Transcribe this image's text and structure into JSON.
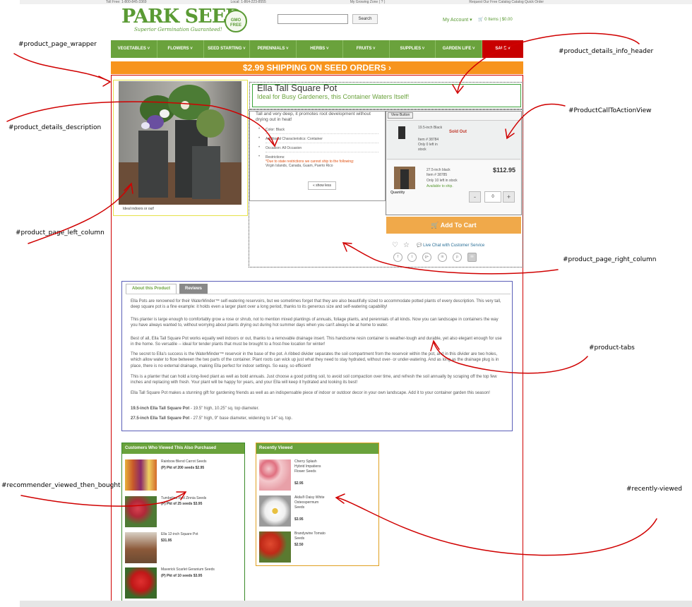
{
  "header": {
    "toll_free": "Toll Free: 1-800-845-3369",
    "local": "Local: 1-864-223-8555",
    "growing_zone": "My Growing Zone (  ?  )",
    "top_links": "Request Our Free Catalog  Catalog Quick Order",
    "brand": "PARK SEED",
    "tagline": "Superior Germination Guaranteed!",
    "gmo_badge": "GMO FREE",
    "search_placeholder": "",
    "search_button": "Search",
    "account": "My Account ▾",
    "cart": "0 Items | $0.00"
  },
  "nav": {
    "items": [
      "VEGETABLES ˅",
      "FLOWERS ˅",
      "SEED STARTING ˅",
      "PERENNIALS ˅",
      "HERBS ˅",
      "FRUITS ˅",
      "SUPPLIES ˅",
      "GARDEN LIFE ˅",
      "SALE ˅"
    ]
  },
  "promo": {
    "text": "$2.99 SHIPPING ON SEED ORDERS ›"
  },
  "product": {
    "title": "Ella Tall Square Pot",
    "subtitle": "Ideal for Busy Gardeners, this Container Waters Itself!",
    "image_caption": "Ideal indoors or out!",
    "description": "Tall and very deep, it promotes root development without drying out in heat!",
    "specs": [
      {
        "label": "Color:",
        "value": "Black"
      },
      {
        "label": "Additional Characteristics:",
        "value": "Container"
      },
      {
        "label": "Occasion:",
        "value": "All Occasion"
      },
      {
        "label": "Restrictions:",
        "value": "*Due to state restrictions we cannot ship to the following:",
        "extra": "Virgin Islands, Canada, Guam, Puerto Rico"
      }
    ],
    "show_less": "« show less"
  },
  "cta": {
    "view_button": "View Button",
    "option1": {
      "name": "19.5-inch Black",
      "item": "Item # 38784",
      "stock": "Only 0 left in stock",
      "status": "Sold Out"
    },
    "option2": {
      "name": "27.5-inch black",
      "item": "Item # 38785",
      "stock": "Only 10 left in stock",
      "ship": "Available to ship.",
      "price": "$112.95",
      "qty_label": "Quantity",
      "qty": "0",
      "minus": "-",
      "plus": "+"
    },
    "add_to_cart": "Add To Cart",
    "live_chat": "Live Chat with Customer Service",
    "social": [
      "f",
      "t",
      "g+",
      "in",
      "p",
      "✉"
    ]
  },
  "tabs": {
    "about": "About this Product",
    "reviews": "Reviews",
    "paragraphs": [
      "Ella Pots are renowned for their WaterMinder™ self-watering reservoirs, but we sometimes forget that they are also beautifully sized to accommodate potted plants of every description. This very tall, deep square pot is a fine example: it holds even a larger plant over a long period, thanks to its generous size and self-watering capability!",
      "This planter is large enough to comfortably grow a rose or shrub, not to mention mixed plantings of annuals, foliage plants, and perennials of all kinds. Now you can landscape in containers the way you have always wanted to, without worrying about plants drying out during hot summer days when you can't always be at home to water.",
      "Best of all, Ella Tall Square Pot works equally well indoors or out, thanks to a removable drainage insert. This handsome resin container is weather-tough and durable, yet also elegant enough for use in the home. So versatile -- ideal for tender plants that must be brought to a frost-free location for winter!",
      "The secret to Ella's success is the WaterMinder™ reservoir in the base of the pot. A ribbed divider separates the soil compartment from the reservoir within the pot, and in this divider are two holes, which allow water to flow between the two parts of the container. Plant roots can wick up just what they need to stay hydrated, without over- or under-watering. And as long as the drainage plug is in place, there is no external drainage, making Ella perfect for indoor settings. So easy, so efficient!",
      "This is a planter that can hold a long-lived plant as well as bold annuals. Just choose a good potting soil, to avoid soil compaction over time, and refresh the soil annually by scraping off the top few inches and replacing with fresh. Your plant will be happy for years, and your Ella will keep it hydrated and looking its best!",
      "Ella Tall Square Pot makes a stunning gift for gardening friends as well as an indispensable piece of indoor or outdoor decor in your own landscape. Add it to your container garden this season!"
    ],
    "size1_label": "19.5-inch Ella Tall Square Pot",
    "size1_text": " - 19.5\" high, 10.25\" sq. top diameter.",
    "size2_label": "27.5-inch Ella Tall Square Pot",
    "size2_text": " - 27.5\" high, 9\" base diameter, widening to 14\" sq. top."
  },
  "recommender": {
    "heading": "Customers Who Viewed This Also Purchased",
    "items": [
      {
        "name": "Rainbow Blend Carrot Seeds",
        "price": "(P) Pkt of 200 seeds $2.95"
      },
      {
        "name": "Tumbelina Red Zinnia Seeds",
        "price": "(P) Pkt of 25 seeds $3.95"
      },
      {
        "name": "Ella 12-inch Square Pot",
        "price": "$31.95"
      },
      {
        "name": "Maverick Scarlet Geranium Seeds",
        "price": "(P) Pkt of 10 seeds $3.95"
      }
    ]
  },
  "recently_viewed": {
    "heading": "Recently Viewed",
    "items": [
      {
        "name": "Cherry Splash Hybrid Impatiens Flower Seeds",
        "price": "$2.95"
      },
      {
        "name": "Akila® Daisy White Osteospermum Seeds",
        "price": "$3.95"
      },
      {
        "name": "Brandywine Tomato Seeds",
        "price": "$2.50"
      }
    ]
  },
  "annotations": {
    "wrapper": "#product_page_wrapper",
    "info_header": "#product_details_info_header",
    "description": "#product_details_description",
    "cta_view": "#ProductCallToActionView",
    "left_column": "#product_page_left_column",
    "right_column": "#product_page_right_column",
    "product_tabs": "#product-tabs",
    "recommender": "#recommender_viewed_then_bought",
    "recently_viewed": "#recently-viewed"
  },
  "colors": {
    "brand_green": "#6aa23c",
    "sale_red": "#c80000",
    "promo_orange": "#f7941d",
    "annotation_red": "#d00000"
  }
}
